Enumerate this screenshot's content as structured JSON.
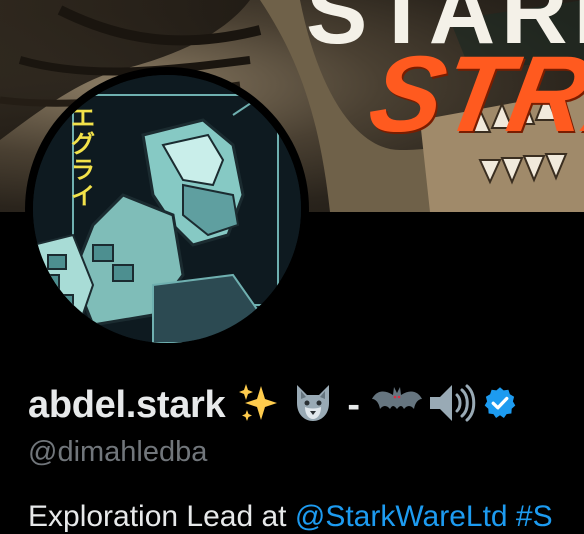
{
  "profile": {
    "display_name": "abdel.stark",
    "name_emojis": [
      "sparkles-emoji",
      "wolf-emoji",
      "dash",
      "bat-emoji",
      "speaker-emoji",
      "verified-badge"
    ],
    "dash_text": "-",
    "handle": "@dimahledba",
    "bio_text": "Exploration Lead at ",
    "bio_link": "@StarkWareLtd #S"
  },
  "banner": {
    "title_white": "STARK",
    "title_orange": "STRA"
  },
  "avatar": {
    "kana_text": "エグライ"
  },
  "colors": {
    "background": "#000000",
    "text_primary": "#e7e9ea",
    "text_secondary": "#71767b",
    "link": "#1d9bf0",
    "verified": "#1d9bf0",
    "banner_accent": "#ff5a1f"
  }
}
